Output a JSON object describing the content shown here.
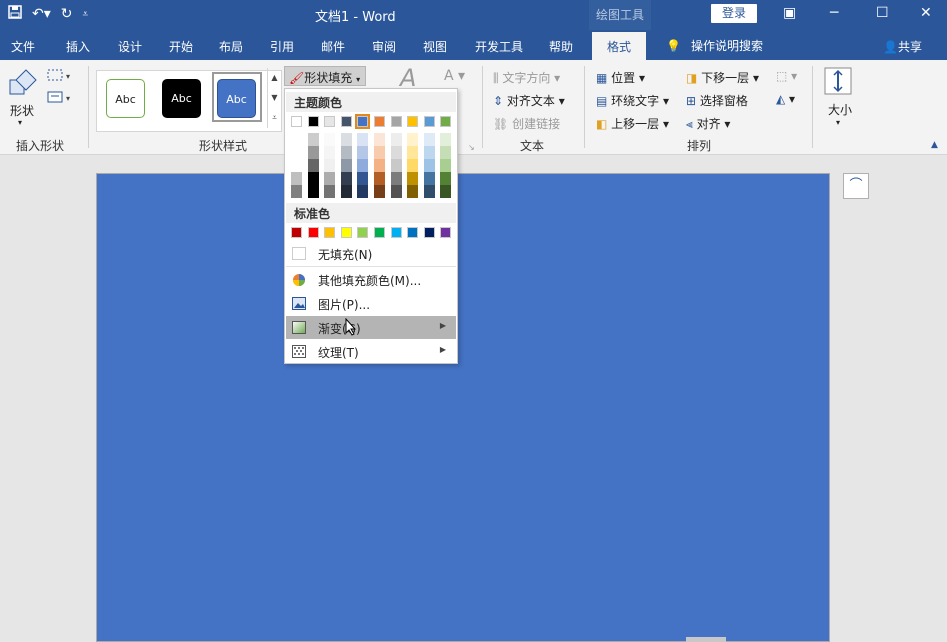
{
  "titlebar": {
    "doc_title": "文档1  -  Word",
    "drawing_tools": "绘图工具",
    "login": "登录",
    "save_icon": "save-icon",
    "undo_icon": "undo-icon",
    "redo_icon": "redo-icon"
  },
  "tabs": {
    "file": "文件",
    "insert": "插入",
    "design": "设计",
    "start": "开始",
    "layout": "布局",
    "references": "引用",
    "mailings": "邮件",
    "review": "审阅",
    "view": "视图",
    "developer": "开发工具",
    "help": "帮助",
    "format": "格式",
    "tell_me": "操作说明搜索",
    "share": "共享"
  },
  "ribbon": {
    "shapes_label": "形状",
    "insert_shapes_group": "插入形状",
    "shape_styles_group": "形状样式",
    "style_sample": "Abc",
    "shape_fill": "形状填充",
    "text_direction": "文字方向",
    "align_text": "对齐文本",
    "create_link": "创建链接",
    "text_group": "文本",
    "position": "位置",
    "wrap_text": "环绕文字",
    "bring_forward": "上移一层",
    "send_backward": "下移一层",
    "selection_pane": "选择窗格",
    "align": "对齐",
    "arrange_group": "排列",
    "size": "大小"
  },
  "dropdown": {
    "theme_colors": "主题颜色",
    "standard_colors": "标准色",
    "no_fill": "无填充(N)",
    "more_colors": "其他填充颜色(M)...",
    "picture": "图片(P)...",
    "gradient": "渐变(G)",
    "texture": "纹理(T)",
    "theme_row": [
      "#ffffff",
      "#000000",
      "#e7e6e6",
      "#44546a",
      "#4472c4",
      "#ed7d31",
      "#a5a5a5",
      "#ffc000",
      "#5b9bd5",
      "#70ad47"
    ],
    "standard_row": [
      "#c00000",
      "#ff0000",
      "#ffc000",
      "#ffff00",
      "#92d050",
      "#00b050",
      "#00b0f0",
      "#0070c0",
      "#002060",
      "#7030a0"
    ]
  },
  "colors": {
    "accent": "#2b579a",
    "shape_fill": "#4472c4"
  }
}
